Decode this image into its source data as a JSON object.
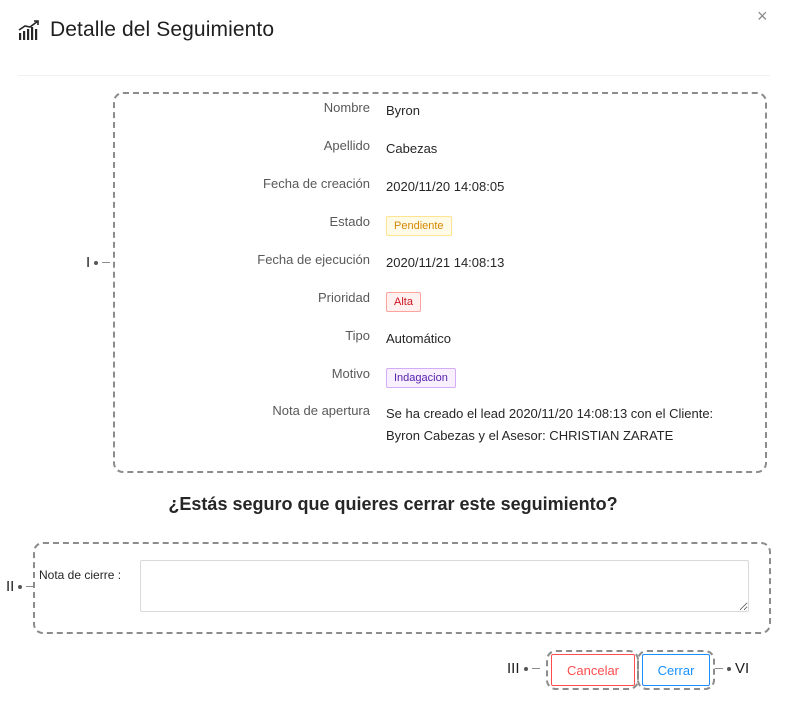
{
  "header": {
    "title": "Detalle del Seguimiento",
    "icon": "chart-growth-icon",
    "close_label": "×"
  },
  "details": [
    {
      "label": "Nombre",
      "value": "Byron"
    },
    {
      "label": "Apellido",
      "value": "Cabezas"
    },
    {
      "label": "Fecha de creación",
      "value": "2020/11/20 14:08:05"
    },
    {
      "label": "Estado",
      "value": "Pendiente"
    },
    {
      "label": "Fecha de ejecución",
      "value": "2020/11/21 14:08:13"
    },
    {
      "label": "Prioridad",
      "value": "Alta"
    },
    {
      "label": "Tipo",
      "value": "Automático"
    },
    {
      "label": "Motivo",
      "value": "Indagacion"
    },
    {
      "label": "Nota de apertura",
      "value_line1": "Se ha creado el lead 2020/11/20 14:08:13 con el Cliente:",
      "value_line2": "Byron Cabezas y el Asesor: CHRISTIAN ZARATE"
    }
  ],
  "question": "¿Estás seguro que quieres cerrar este seguimiento?",
  "form": {
    "note_label": "Nota de cierre",
    "note_colon": ":",
    "note_value": "",
    "note_placeholder": ""
  },
  "buttons": {
    "cancel": "Cancelar",
    "close": "Cerrar"
  },
  "annotations": {
    "m1": "I",
    "m2": "II",
    "m3": "III",
    "m4": "VI"
  },
  "colors": {
    "red": "#ff4d4f",
    "blue": "#1890ff",
    "yellow_tag": "#d48806",
    "purple_tag": "#531dab"
  }
}
